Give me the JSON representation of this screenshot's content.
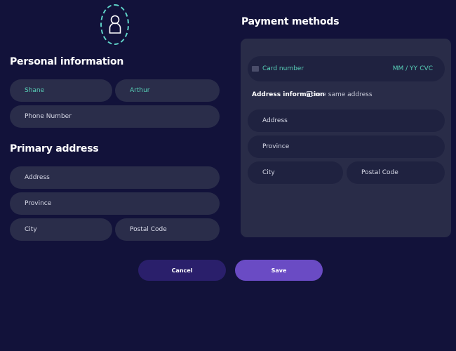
{
  "avatar": {
    "icon": "user-icon",
    "accent": "#5fd3c8"
  },
  "personal": {
    "heading": "Personal information",
    "first_name": "Shane",
    "last_name": "Arthur",
    "phone_placeholder": "Phone Number"
  },
  "primary_address": {
    "heading": "Primary address",
    "address_placeholder": "Address",
    "province_placeholder": "Province",
    "city_placeholder": "City",
    "postal_placeholder": "Postal Code"
  },
  "payment": {
    "heading": "Payment methods",
    "card_icon": "credit-card-icon",
    "card_number_placeholder": "Card number",
    "expiry_placeholder": "MM / YY",
    "cvc_placeholder": "CVC",
    "address_info_label": "Address information",
    "same_address_label": "use same address",
    "same_address_checked": false,
    "address_placeholder": "Address",
    "province_placeholder": "Province",
    "city_placeholder": "City",
    "postal_placeholder": "Postal Code"
  },
  "actions": {
    "cancel_label": "Cancel",
    "save_label": "Save"
  },
  "colors": {
    "background": "#12123a",
    "field": "#2a2d4a",
    "filled_text": "#58d0b8",
    "cancel": "#2a1f6b",
    "save": "#6a4bc4"
  }
}
